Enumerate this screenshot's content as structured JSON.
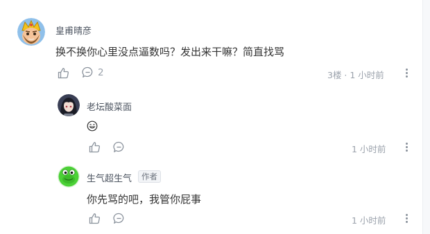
{
  "comments": [
    {
      "author": "皇甫晴彦",
      "text": "换不换你心里没点逼数吗？发出来干嘛？简直找骂",
      "reply_count": "2",
      "floor_time": "3楼 · 1 小时前",
      "avatar_icon": "clash-king-avatar"
    }
  ],
  "replies": [
    {
      "author": "老坛酸菜面",
      "text": "😊",
      "time": "1 小时前",
      "avatar_icon": "dark-hair-character-avatar"
    },
    {
      "author": "生气超生气",
      "author_badge": "作者",
      "text": "你先骂的吧，我管你屁事",
      "time": "1 小时前",
      "avatar_icon": "green-frog-avatar"
    }
  ],
  "colors": {
    "text": "#333333",
    "name": "#4d5561",
    "meta": "#9aa1ab",
    "frog_green": "#4cd137"
  }
}
